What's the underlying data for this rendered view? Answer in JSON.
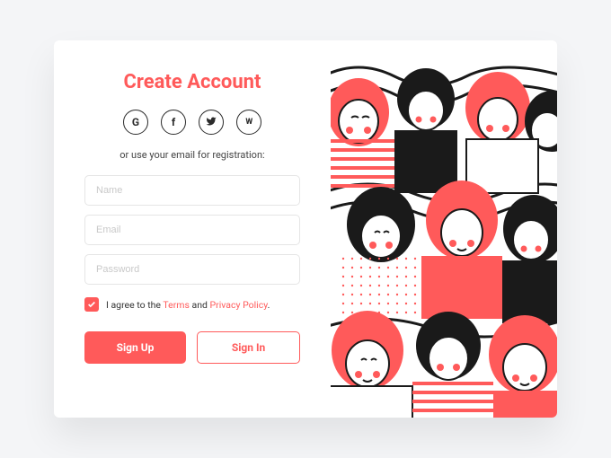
{
  "colors": {
    "accent": "#ff5a5a",
    "text": "#2b2b2b",
    "border": "#e5e5e5"
  },
  "title": "Create Account",
  "socials": [
    {
      "name": "google",
      "glyph": "G"
    },
    {
      "name": "facebook",
      "glyph": "f"
    },
    {
      "name": "twitter",
      "glyph": "t"
    },
    {
      "name": "vk",
      "glyph": "vk"
    }
  ],
  "subtitle": "or use your email for registration:",
  "fields": {
    "name": {
      "placeholder": "Name",
      "value": ""
    },
    "email": {
      "placeholder": "Email",
      "value": ""
    },
    "password": {
      "placeholder": "Password",
      "value": ""
    }
  },
  "agree": {
    "checked": true,
    "pre": "I agree to the ",
    "terms": "Terms",
    "mid": " and ",
    "privacy": "Privacy Policy",
    "post": "."
  },
  "buttons": {
    "signup": "Sign Up",
    "signin": "Sign In"
  }
}
